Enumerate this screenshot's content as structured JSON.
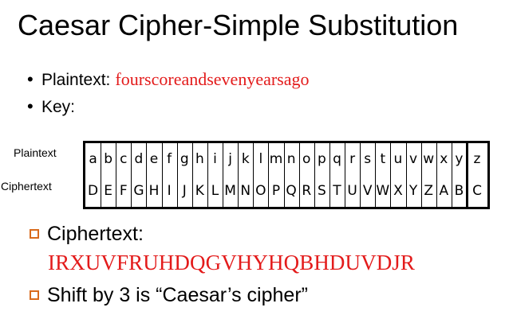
{
  "title": "Caesar Cipher-Simple Substitution",
  "bullets": {
    "plaintext_label": "Plaintext:",
    "plaintext_value": "fourscoreandsevenyearsago",
    "key_label": "Key:"
  },
  "mapping": {
    "plaintext_row_label": "Plaintext",
    "ciphertext_row_label": "Ciphertext",
    "plaintext_letters": [
      "a",
      "b",
      "c",
      "d",
      "e",
      "f",
      "g",
      "h",
      "i",
      "j",
      "k",
      "l",
      "m",
      "n",
      "o",
      "p",
      "q",
      "r",
      "s",
      "t",
      "u",
      "v",
      "w",
      "x",
      "y",
      "z"
    ],
    "ciphertext_letters": [
      "D",
      "E",
      "F",
      "G",
      "H",
      "I",
      "J",
      "K",
      "L",
      "M",
      "N",
      "O",
      "P",
      "Q",
      "R",
      "S",
      "T",
      "U",
      "V",
      "W",
      "X",
      "Y",
      "Z",
      "A",
      "B",
      "C"
    ]
  },
  "ciphertext": {
    "label": "Ciphertext:",
    "value": "IRXUVFRUHDQGVHYHQBHDUVDJR"
  },
  "note": {
    "text": "Shift by 3 is “Caesar’s cipher”"
  },
  "colors": {
    "accent_text": "#e31b1b",
    "square_bullet": "#d96b1d"
  }
}
